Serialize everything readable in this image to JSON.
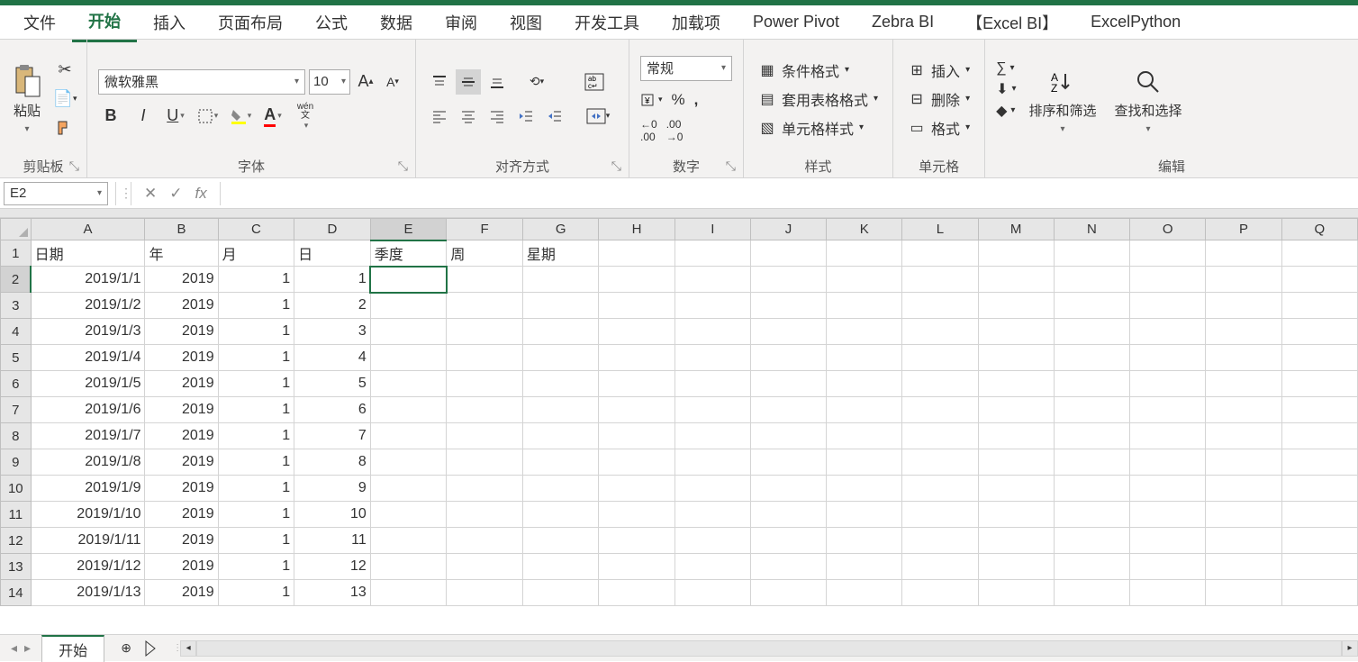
{
  "tabs": [
    "文件",
    "开始",
    "插入",
    "页面布局",
    "公式",
    "数据",
    "审阅",
    "视图",
    "开发工具",
    "加载项",
    "Power Pivot",
    "Zebra BI",
    "【Excel BI】",
    "ExcelPython"
  ],
  "active_tab": "开始",
  "ribbon": {
    "clipboard": {
      "label": "剪贴板",
      "paste": "粘贴"
    },
    "font": {
      "label": "字体",
      "name": "微软雅黑",
      "size": "10",
      "wen": "wén",
      "wen2": "文"
    },
    "align": {
      "label": "对齐方式"
    },
    "number": {
      "label": "数字",
      "format": "常规"
    },
    "styles": {
      "label": "样式",
      "cond": "条件格式",
      "table": "套用表格格式",
      "cell": "单元格样式"
    },
    "cells": {
      "label": "单元格",
      "insert": "插入",
      "delete": "删除",
      "format": "格式"
    },
    "edit": {
      "label": "编辑",
      "sort": "排序和筛选",
      "find": "查找和选择"
    }
  },
  "namebox": "E2",
  "fx": "fx",
  "columns": [
    "A",
    "B",
    "C",
    "D",
    "E",
    "F",
    "G",
    "H",
    "I",
    "J",
    "K",
    "L",
    "M",
    "N",
    "O",
    "P",
    "Q"
  ],
  "headers": {
    "A": "日期",
    "B": "年",
    "C": "月",
    "D": "日",
    "E": "季度",
    "F": "周",
    "G": "星期"
  },
  "rows": [
    {
      "n": 1
    },
    {
      "n": 2,
      "A": "2019/1/1",
      "B": "2019",
      "C": "1",
      "D": "1"
    },
    {
      "n": 3,
      "A": "2019/1/2",
      "B": "2019",
      "C": "1",
      "D": "2"
    },
    {
      "n": 4,
      "A": "2019/1/3",
      "B": "2019",
      "C": "1",
      "D": "3"
    },
    {
      "n": 5,
      "A": "2019/1/4",
      "B": "2019",
      "C": "1",
      "D": "4"
    },
    {
      "n": 6,
      "A": "2019/1/5",
      "B": "2019",
      "C": "1",
      "D": "5"
    },
    {
      "n": 7,
      "A": "2019/1/6",
      "B": "2019",
      "C": "1",
      "D": "6"
    },
    {
      "n": 8,
      "A": "2019/1/7",
      "B": "2019",
      "C": "1",
      "D": "7"
    },
    {
      "n": 9,
      "A": "2019/1/8",
      "B": "2019",
      "C": "1",
      "D": "8"
    },
    {
      "n": 10,
      "A": "2019/1/9",
      "B": "2019",
      "C": "1",
      "D": "9"
    },
    {
      "n": 11,
      "A": "2019/1/10",
      "B": "2019",
      "C": "1",
      "D": "10"
    },
    {
      "n": 12,
      "A": "2019/1/11",
      "B": "2019",
      "C": "1",
      "D": "11"
    },
    {
      "n": 13,
      "A": "2019/1/12",
      "B": "2019",
      "C": "1",
      "D": "12"
    },
    {
      "n": 14,
      "A": "2019/1/13",
      "B": "2019",
      "C": "1",
      "D": "13"
    }
  ],
  "active_cell": {
    "col": "E",
    "row": 2
  },
  "sheet_tab": "开始"
}
